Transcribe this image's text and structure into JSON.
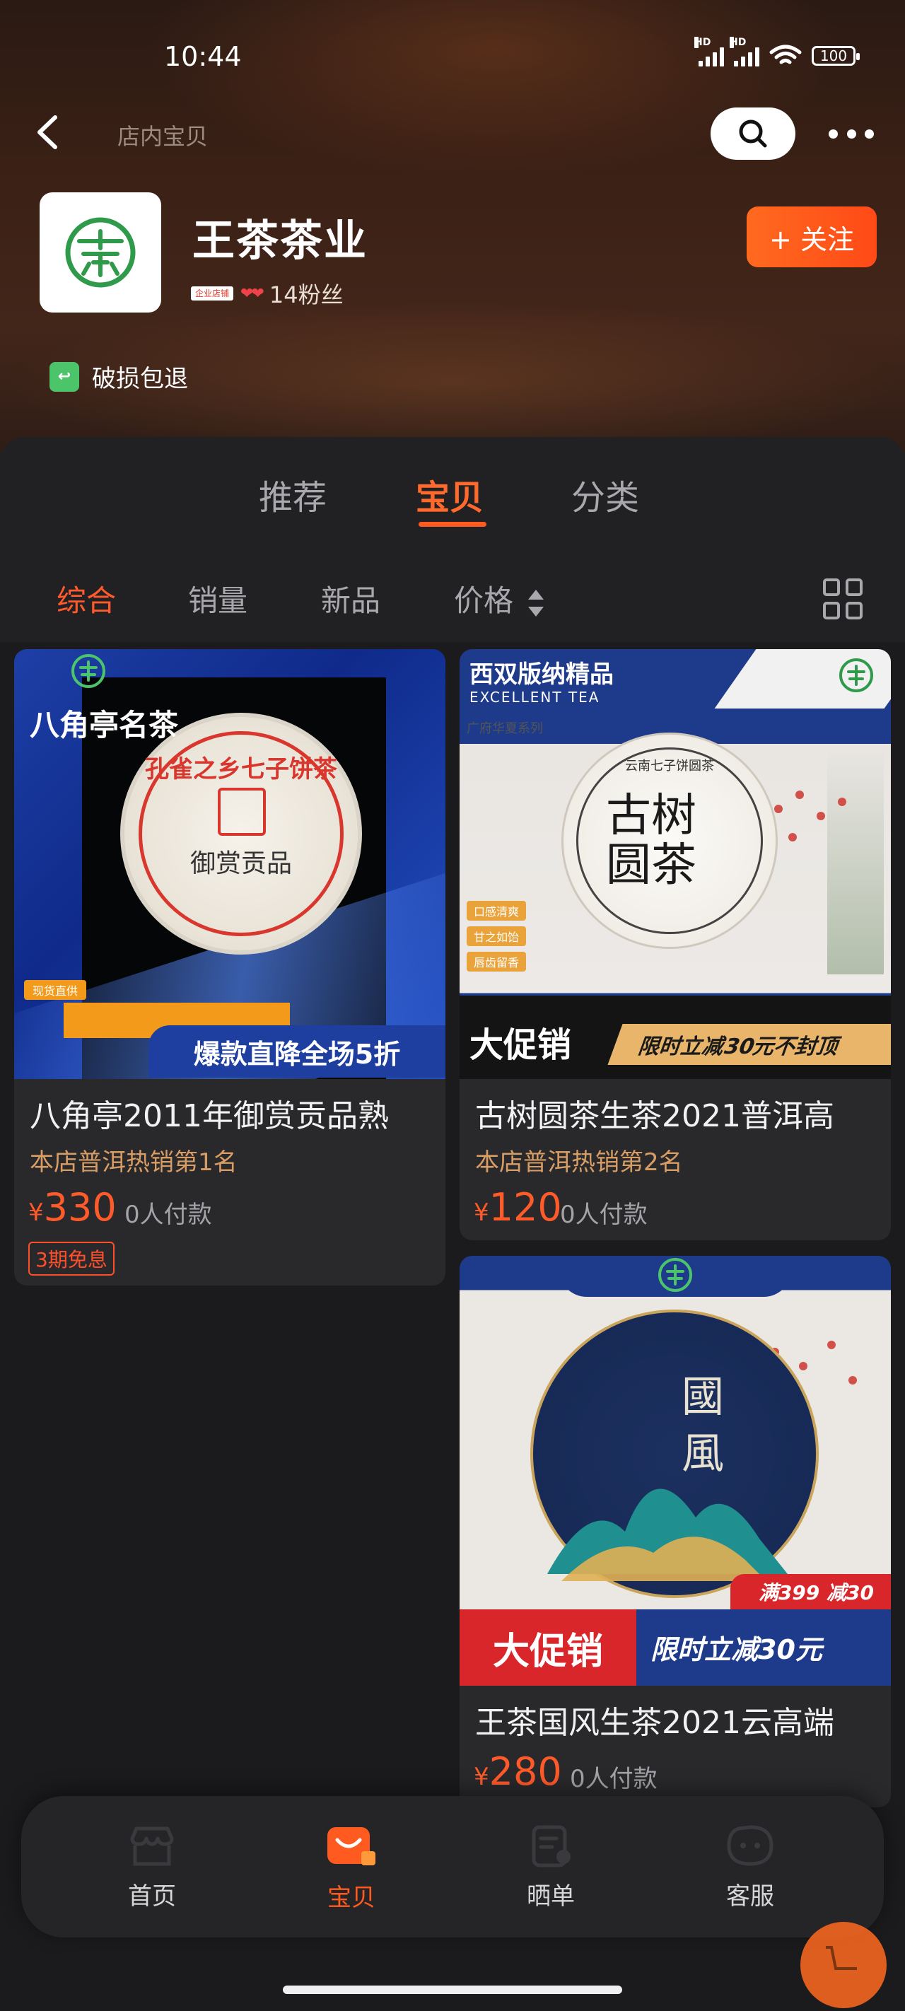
{
  "status_bar": {
    "time": "10:44",
    "battery": "100",
    "signal_label_1": "HD",
    "signal_label_2": "HD"
  },
  "header": {
    "search_placeholder": "店内宝贝",
    "store_name": "王茶茶业",
    "store_badge": "企业店铺",
    "fans": "14粉丝",
    "follow_label": "+ 关注",
    "guarantee": "破损包退"
  },
  "main_tabs": [
    {
      "label": "推荐",
      "active": false
    },
    {
      "label": "宝贝",
      "active": true
    },
    {
      "label": "分类",
      "active": false
    }
  ],
  "sub_tabs": [
    {
      "label": "综合",
      "active": true
    },
    {
      "label": "销量",
      "active": false
    },
    {
      "label": "新品",
      "active": false
    },
    {
      "label": "价格",
      "active": false
    }
  ],
  "products": [
    {
      "image_overlay_title": "八角亭名茶",
      "image_cake_text": "孔雀之乡七子饼茶",
      "image_cake_sub": "御赏贡品",
      "image_tag": "现货直供",
      "image_banner": "爆款直降全场5折",
      "title": "八角亭2011年御赏贡品熟",
      "rank": "本店普洱热销第1名",
      "currency": "¥",
      "price": "330",
      "paid": "0人付款",
      "installment": "3期免息"
    },
    {
      "image_heading": "西双版纳精品",
      "image_subheading": "EXCELLENT TEA",
      "image_series": "广府华夏系列",
      "image_cake_text": "古树圆茶",
      "image_cake_ring": "云南七子饼圆茶",
      "image_tags": [
        "口感清爽",
        "甘之如饴",
        "唇齿留香"
      ],
      "image_promo": "大促销",
      "image_promo_detail": "限时立减30元不封顶",
      "title": "古树圆茶生茶2021普洱高",
      "rank": "本店普洱热销第2名",
      "currency": "¥",
      "price": "120",
      "paid": "0人付款"
    },
    {
      "image_cake_text": "國風",
      "image_coupon": "满399 减30",
      "image_promo": "大促销",
      "image_promo_detail": "限时立减30元",
      "title": "王茶国风生茶2021云高端",
      "currency": "¥",
      "price": "280",
      "paid": "0人付款"
    }
  ],
  "bottom_nav": [
    {
      "label": "首页",
      "icon": "shop-icon",
      "active": false
    },
    {
      "label": "宝贝",
      "icon": "bag-icon",
      "active": true
    },
    {
      "label": "晒单",
      "icon": "receipt-icon",
      "active": false
    },
    {
      "label": "客服",
      "icon": "service-icon",
      "active": false
    }
  ],
  "colors": {
    "accent": "#ff5a1f",
    "price": "#ff5a2a",
    "rank": "#d89d65",
    "background": "#1b1b1d"
  }
}
